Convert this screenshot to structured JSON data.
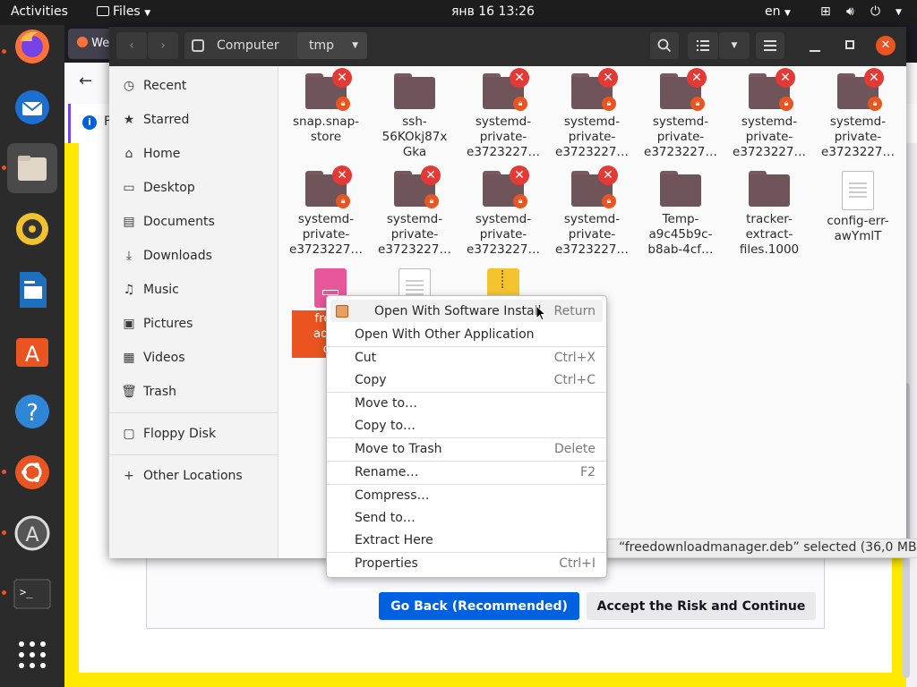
{
  "topbar": {
    "activities": "Activities",
    "app_menu": "Files",
    "datetime": "янв 16  13:26",
    "lang": "en"
  },
  "browser": {
    "tab_partial": "We",
    "info_partial": "F",
    "go_back": "Go Back (Recommended)",
    "accept_risk": "Accept the Risk and Continue"
  },
  "files": {
    "path": [
      "Computer",
      "tmp"
    ],
    "sidebar": {
      "items": [
        {
          "label": "Recent",
          "icon": "clock-icon"
        },
        {
          "label": "Starred",
          "icon": "star-icon"
        },
        {
          "label": "Home",
          "icon": "home-icon"
        },
        {
          "label": "Desktop",
          "icon": "desktop-icon"
        },
        {
          "label": "Documents",
          "icon": "documents-icon"
        },
        {
          "label": "Downloads",
          "icon": "downloads-icon"
        },
        {
          "label": "Music",
          "icon": "music-icon"
        },
        {
          "label": "Pictures",
          "icon": "pictures-icon"
        },
        {
          "label": "Videos",
          "icon": "videos-icon"
        },
        {
          "label": "Trash",
          "icon": "trash-icon"
        }
      ],
      "floppy": "Floppy Disk",
      "other": "Other Locations"
    },
    "grid": {
      "r1": [
        {
          "l1": "snap.snap-",
          "l2": "store",
          "l3": ""
        },
        {
          "l1": "ssh-",
          "l2": "56KOkj87x",
          "l3": "Gka"
        },
        {
          "l1": "systemd-",
          "l2": "private-",
          "l3": "e3723227…"
        },
        {
          "l1": "systemd-",
          "l2": "private-",
          "l3": "e3723227…"
        },
        {
          "l1": "systemd-",
          "l2": "private-",
          "l3": "e3723227…"
        },
        {
          "l1": "systemd-",
          "l2": "private-",
          "l3": "e3723227…"
        },
        {
          "l1": "systemd-",
          "l2": "private-",
          "l3": "e3723227…"
        }
      ],
      "r2": [
        {
          "l1": "systemd-",
          "l2": "private-",
          "l3": "e3723227…"
        },
        {
          "l1": "systemd-",
          "l2": "private-",
          "l3": "e3723227…"
        },
        {
          "l1": "systemd-",
          "l2": "private-",
          "l3": "e3723227…"
        },
        {
          "l1": "systemd-",
          "l2": "private-",
          "l3": "e3723227…"
        },
        {
          "l1": "Temp-",
          "l2": "a9c45b9c-",
          "l3": "b8ab-4cf…"
        },
        {
          "l1": "tracker-",
          "l2": "extract-",
          "l3": "files.1000"
        },
        {
          "l1": "config-err-",
          "l2": "awYmlT",
          "l3": ""
        }
      ],
      "r3_selected": {
        "l1": "freed",
        "l2": "adma",
        "l3": "de"
      }
    },
    "status": "“freedownloadmanager.deb” selected  (36,0 MB)"
  },
  "menu": {
    "items": [
      {
        "label": "Open With Software Install",
        "acc": "Return"
      },
      {
        "label": "Open With Other Application",
        "acc": ""
      },
      {
        "label": "Cut",
        "acc": "Ctrl+X"
      },
      {
        "label": "Copy",
        "acc": "Ctrl+C"
      },
      {
        "label": "Move to…",
        "acc": ""
      },
      {
        "label": "Copy to…",
        "acc": ""
      },
      {
        "label": "Move to Trash",
        "acc": "Delete"
      },
      {
        "label": "Rename…",
        "acc": "F2"
      },
      {
        "label": "Compress…",
        "acc": ""
      },
      {
        "label": "Send to…",
        "acc": ""
      },
      {
        "label": "Extract Here",
        "acc": ""
      },
      {
        "label": "Properties",
        "acc": "Ctrl+I"
      }
    ]
  },
  "colors": {
    "ubuntu_orange": "#e95420",
    "firefox_blue": "#0061e0",
    "warning_yellow": "#ffe900",
    "folder_locked": "#6f5459",
    "error_red": "#e53935"
  }
}
